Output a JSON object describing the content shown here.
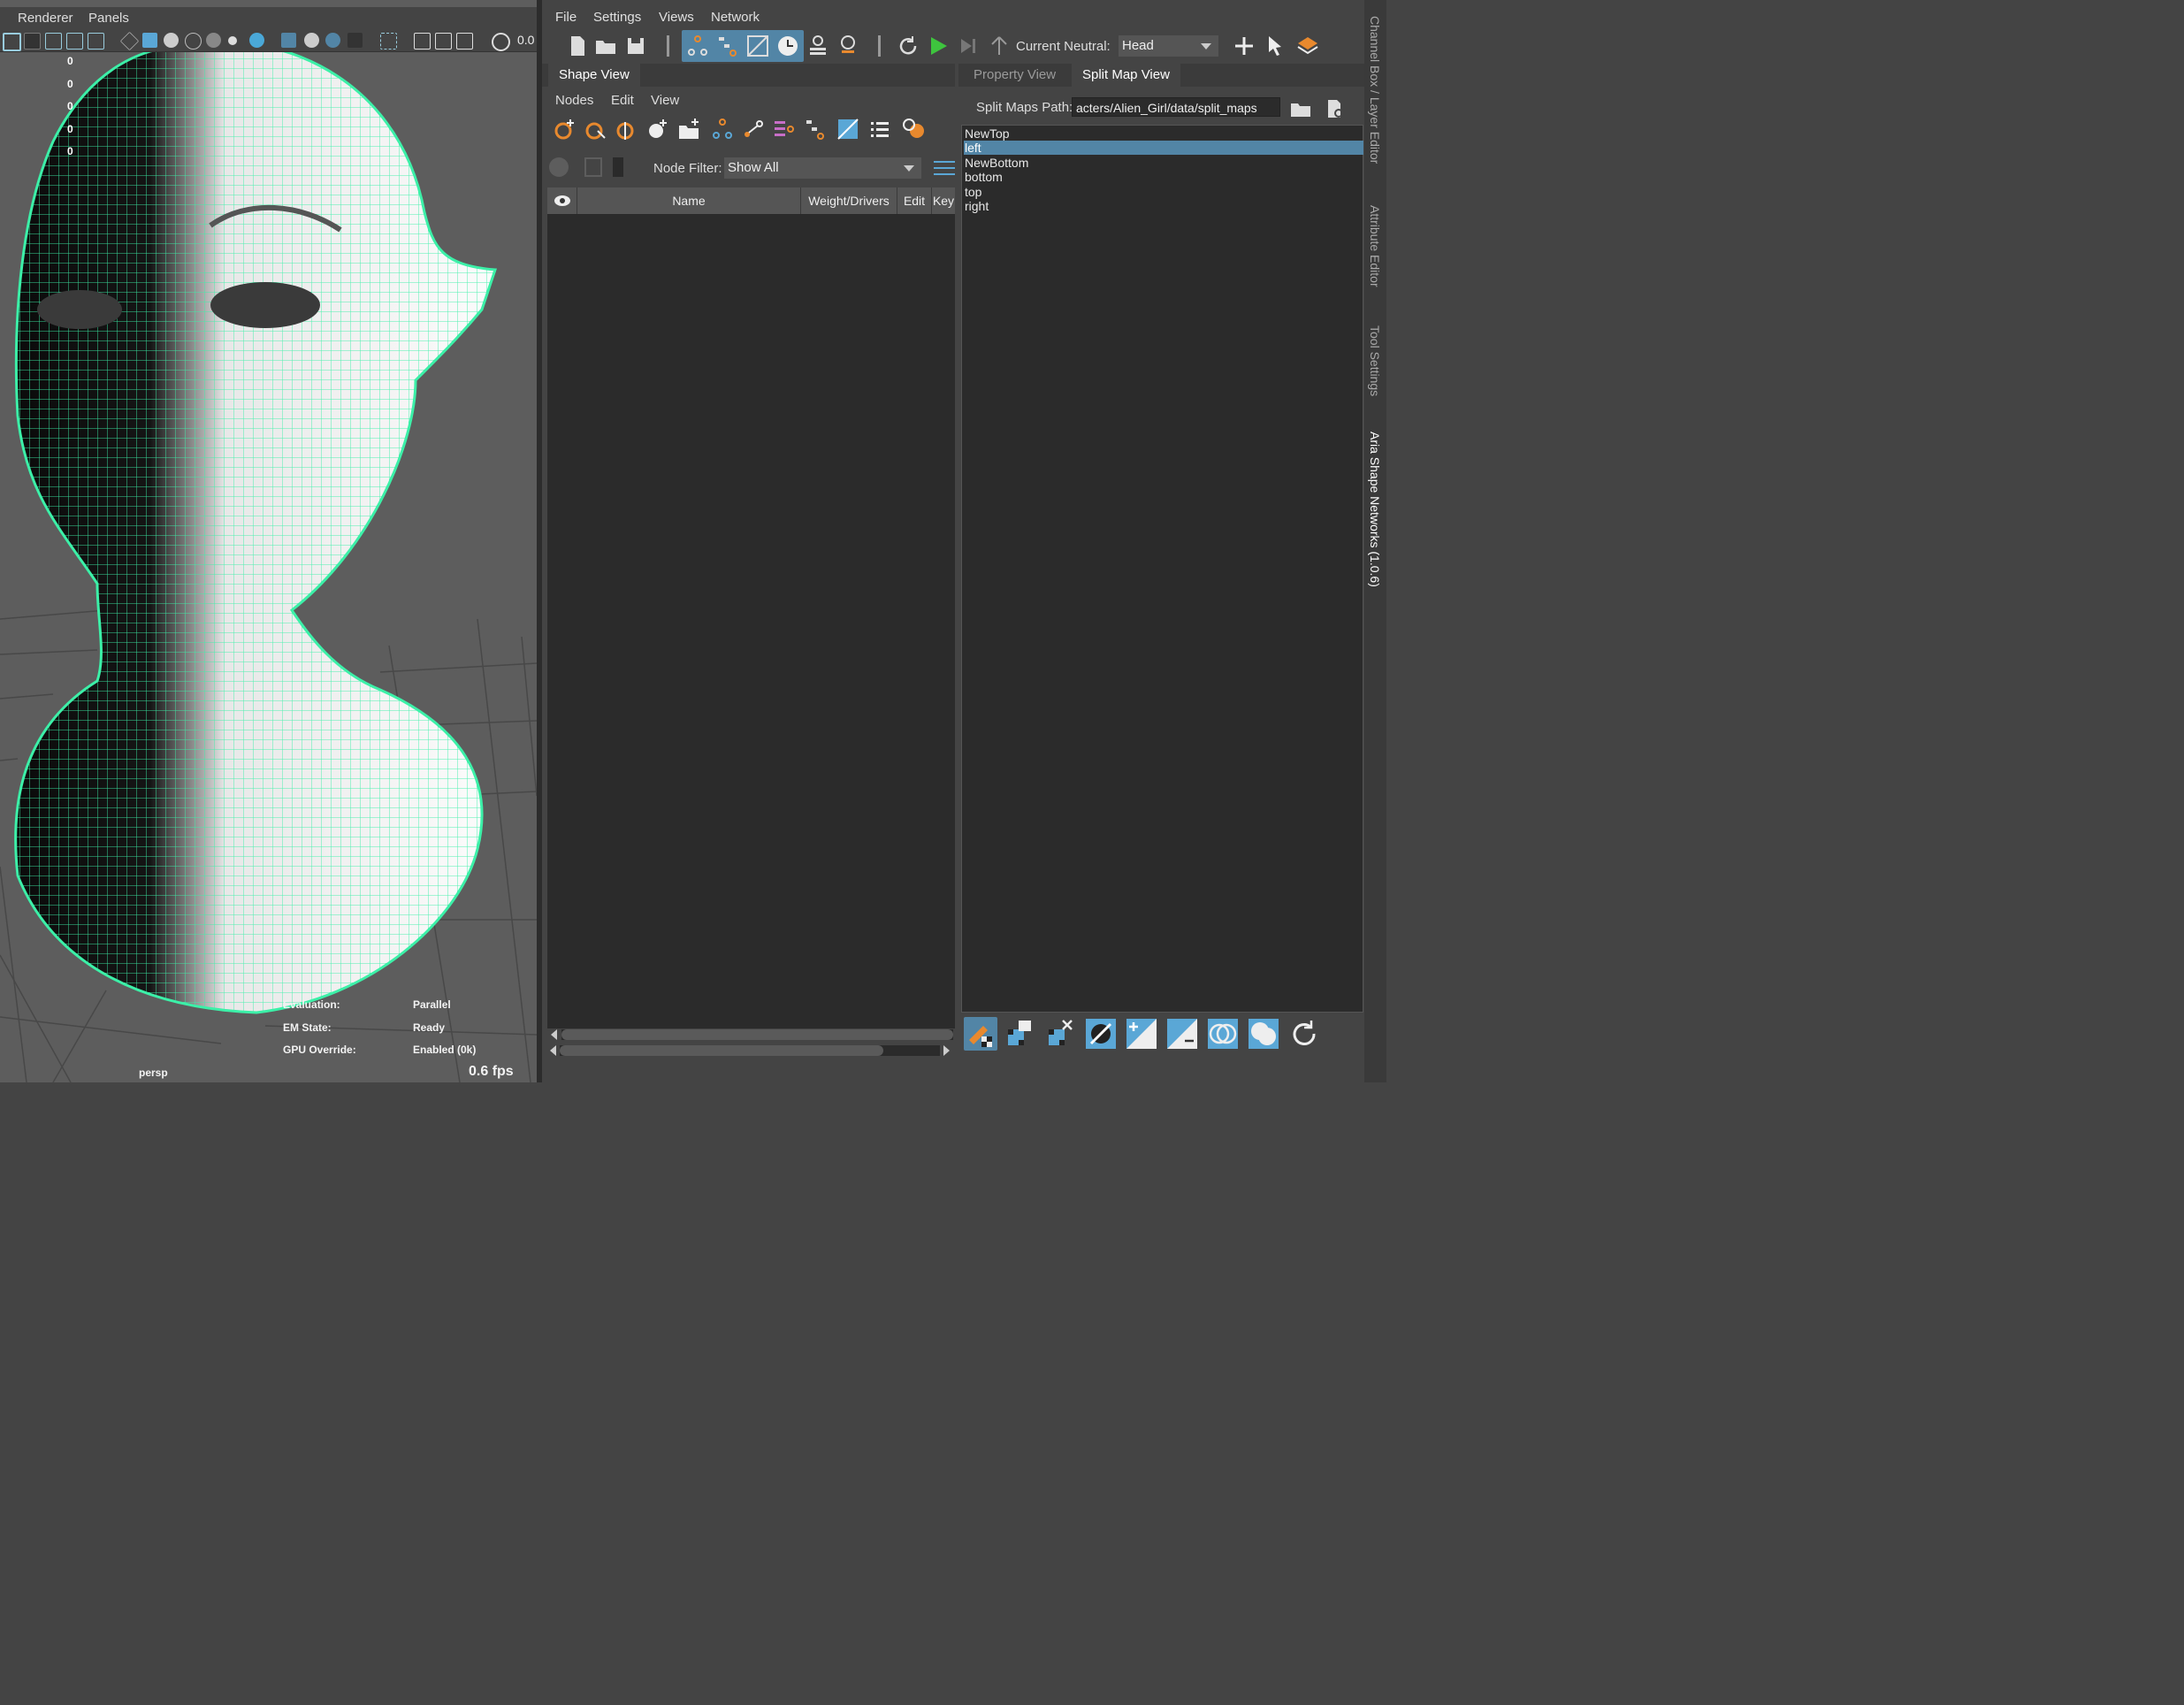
{
  "viewport": {
    "menu": [
      "Renderer",
      "Panels"
    ],
    "zoom_value": "0.0",
    "hud_counts": [
      "0",
      "0",
      "0",
      "0",
      "0"
    ],
    "hud": {
      "evaluation_label": "Evaluation:",
      "evaluation_value": "Parallel",
      "em_state_label": "EM State:",
      "em_state_value": "Ready",
      "gpu_override_label": "GPU Override:",
      "gpu_override_value": "Enabled (0k)"
    },
    "camera_name": "persp",
    "fps": "0.6 fps",
    "colors": {
      "wireframe": "#3cf0a8",
      "background": "#5d5d5d"
    }
  },
  "main_menu": [
    "File",
    "Settings",
    "Views",
    "Network"
  ],
  "toolbar": {
    "current_neutral_label": "Current Neutral:",
    "current_neutral_value": "Head"
  },
  "shape_view": {
    "tab_label": "Shape View",
    "menu": [
      "Nodes",
      "Edit",
      "View"
    ],
    "node_filter_label": "Node Filter:",
    "node_filter_value": "Show All",
    "columns": [
      "Name",
      "Weight/Drivers",
      "Edit",
      "Key"
    ]
  },
  "split_map_view": {
    "tabs": [
      "Property View",
      "Split Map View"
    ],
    "path_label": "Split Maps Path:",
    "path_value": "acters/Alien_Girl/data/split_maps",
    "items": [
      "NewTop",
      "left",
      "NewBottom",
      "bottom",
      "top",
      "right"
    ],
    "selected_index": 1
  },
  "side_tabs": [
    "Channel Box / Layer Editor",
    "Attribute Editor",
    "Tool Settings",
    "Aria Shape Networks (1.0.6)"
  ],
  "colors": {
    "accent": "#5285a6",
    "play_green": "#3ec43e",
    "node_orange": "#e8892e"
  }
}
